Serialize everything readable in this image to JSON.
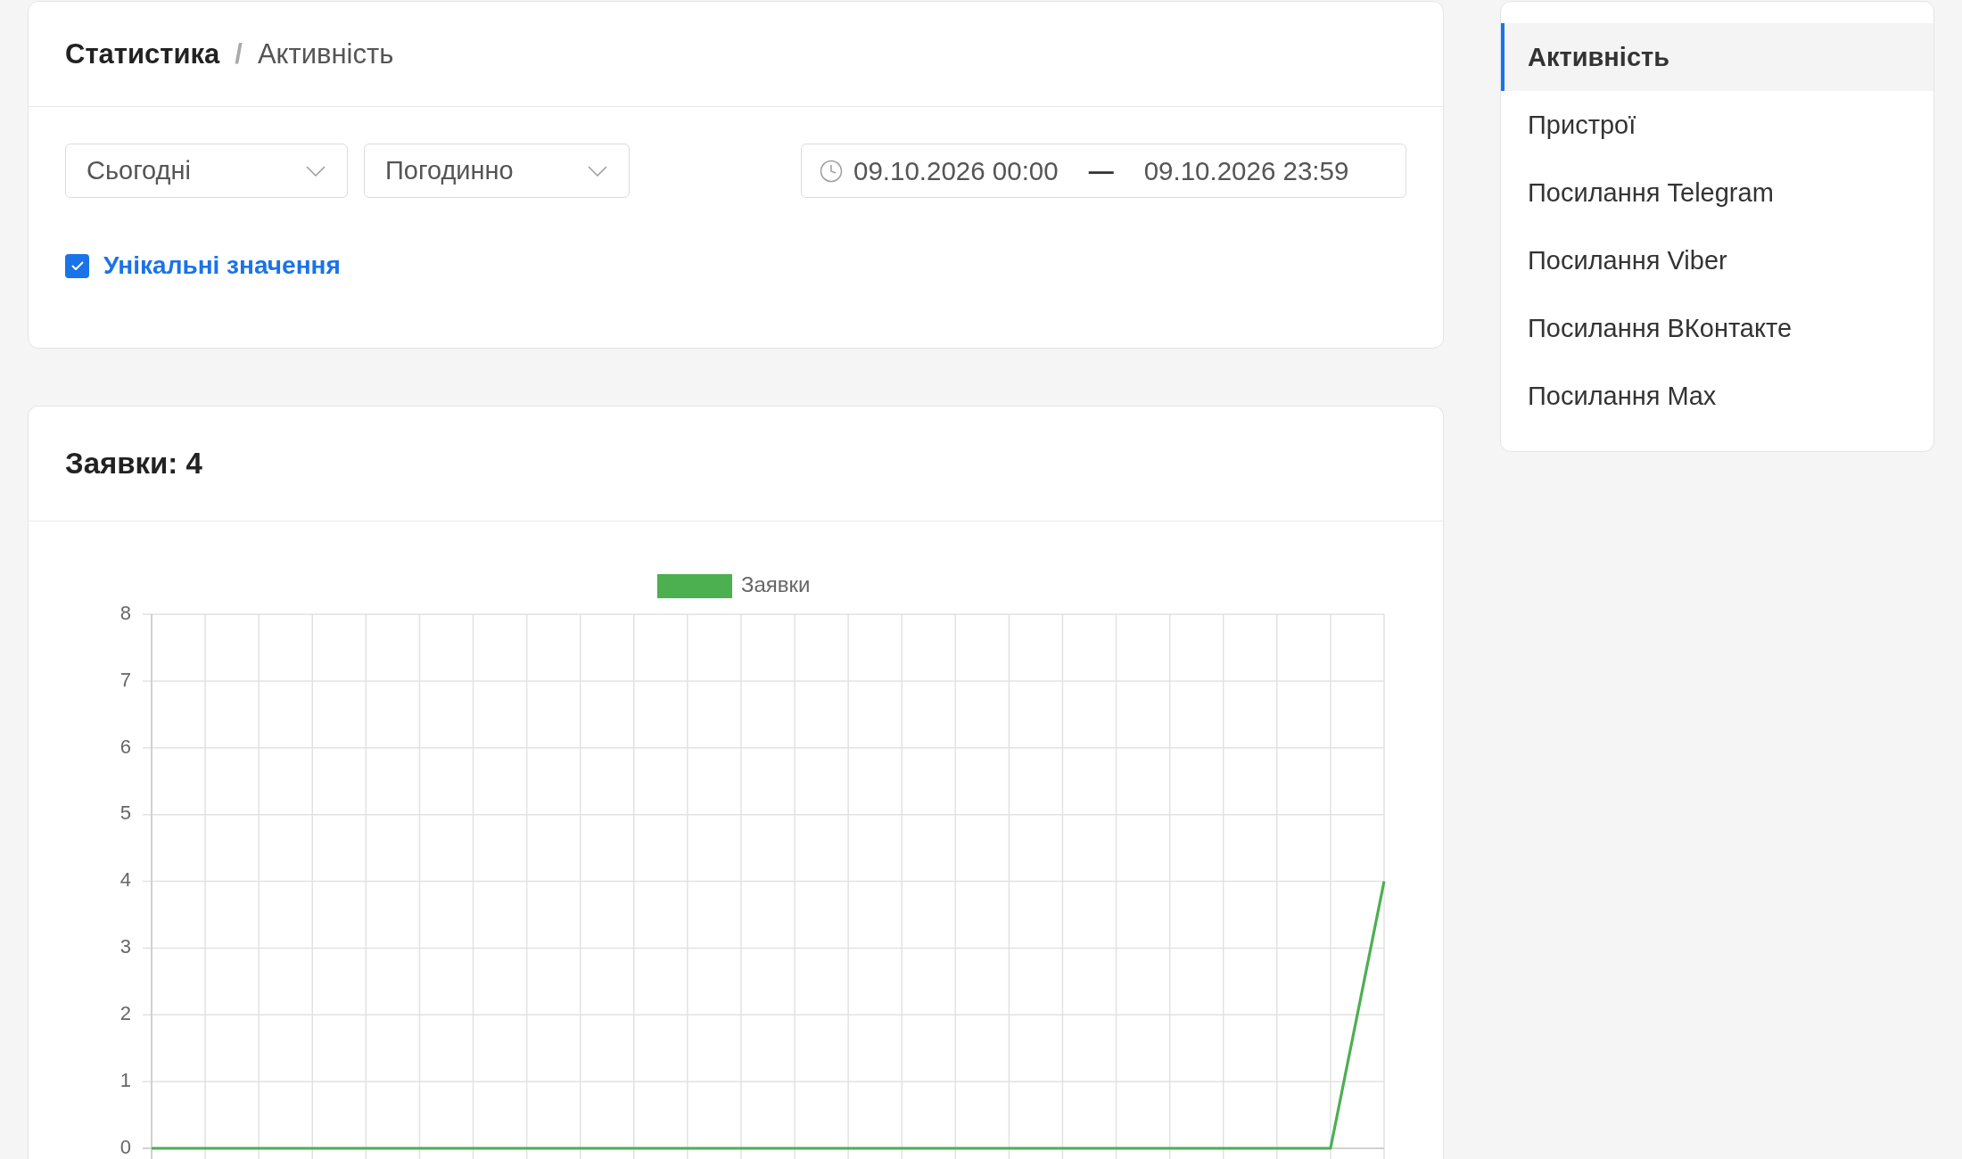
{
  "breadcrumb": {
    "items": [
      "Статистика",
      "Активність"
    ],
    "separator": "/"
  },
  "filters": {
    "period": {
      "value": "Сьогодні"
    },
    "grouping": {
      "value": "Погодинно"
    },
    "date_range": {
      "start": "09.10.2026 00:00",
      "separator": "—",
      "end": "09.10.2026 23:59"
    },
    "unique_values": {
      "label": "Унікальні значення",
      "checked": true
    }
  },
  "requests_panel": {
    "title": "Заявки: 4",
    "chart_data": {
      "type": "line",
      "series": [
        {
          "name": "Заявки",
          "color": "#4caf50",
          "values": [
            0,
            0,
            0,
            0,
            0,
            0,
            0,
            0,
            0,
            0,
            0,
            0,
            0,
            0,
            0,
            0,
            0,
            0,
            0,
            0,
            0,
            0,
            0,
            4
          ]
        }
      ],
      "ylim": [
        0,
        8
      ],
      "yticks": [
        0,
        1,
        2,
        3,
        4,
        5,
        6,
        7,
        8
      ],
      "grid": true
    }
  },
  "sidebar": {
    "items": [
      {
        "label": "Активність",
        "selected": true
      },
      {
        "label": "Пристрої",
        "selected": false
      },
      {
        "label": "Посилання Telegram",
        "selected": false
      },
      {
        "label": "Посилання Viber",
        "selected": false
      },
      {
        "label": "Посилання ВКонтакте",
        "selected": false
      },
      {
        "label": "Посилання Max",
        "selected": false
      }
    ]
  }
}
